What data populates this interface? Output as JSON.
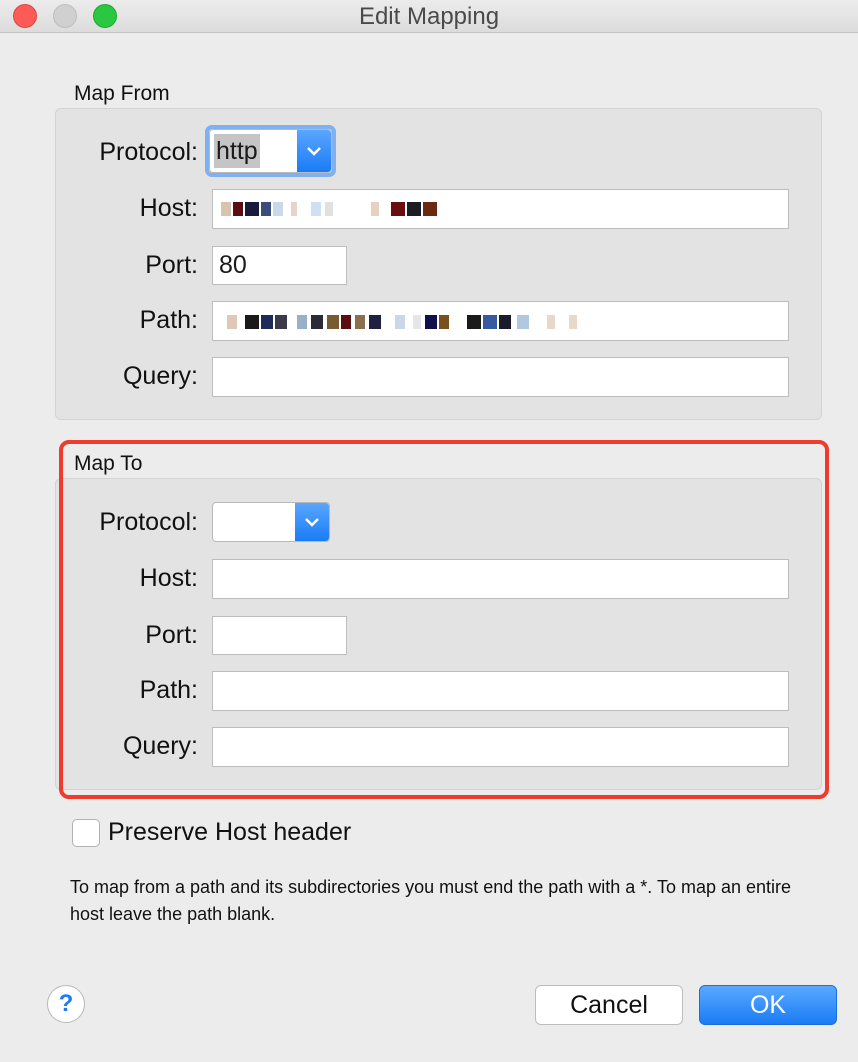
{
  "window": {
    "title": "Edit Mapping"
  },
  "map_from": {
    "label": "Map From",
    "protocol_label": "Protocol:",
    "protocol_value": "http",
    "host_label": "Host:",
    "host_value": "",
    "port_label": "Port:",
    "port_value": "80",
    "path_label": "Path:",
    "path_value": "",
    "query_label": "Query:",
    "query_value": ""
  },
  "map_to": {
    "label": "Map To",
    "protocol_label": "Protocol:",
    "protocol_value": "",
    "host_label": "Host:",
    "host_value": "",
    "port_label": "Port:",
    "port_value": "",
    "path_label": "Path:",
    "path_value": "",
    "query_label": "Query:",
    "query_value": ""
  },
  "preserve_host": {
    "label": "Preserve Host header",
    "checked": false
  },
  "help_text": "To map from a path and its subdirectories you must end the path with a *. To map an entire host leave the path blank.",
  "buttons": {
    "help": "?",
    "cancel": "Cancel",
    "ok": "OK"
  },
  "colors": {
    "accent": "#1a7cf5",
    "highlight": "#f03a2e",
    "close": "#fc5b57",
    "zoom": "#2ac840"
  }
}
